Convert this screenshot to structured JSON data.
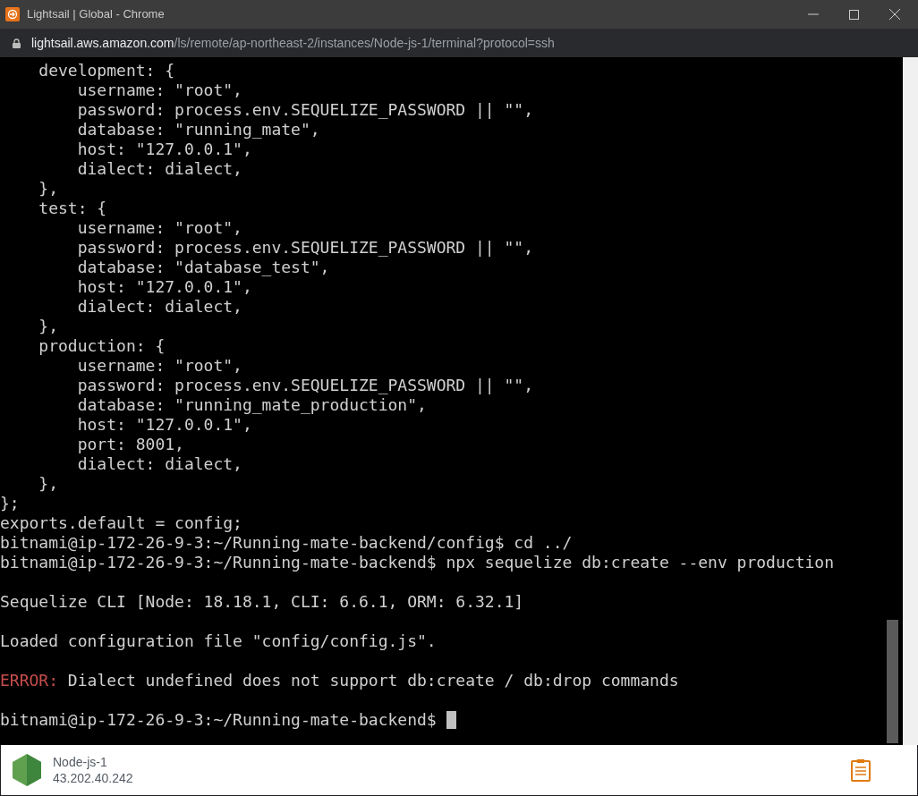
{
  "window": {
    "title": "Lightsail | Global - Chrome"
  },
  "address_bar": {
    "host": "lightsail.aws.amazon.com",
    "path": "/ls/remote/ap-northeast-2/instances/Node-js-1/terminal?protocol=ssh"
  },
  "terminal": {
    "lines": [
      {
        "kind": "plain",
        "text": "    development: {"
      },
      {
        "kind": "plain",
        "text": "        username: \"root\","
      },
      {
        "kind": "plain",
        "text": "        password: process.env.SEQUELIZE_PASSWORD || \"\","
      },
      {
        "kind": "plain",
        "text": "        database: \"running_mate\","
      },
      {
        "kind": "plain",
        "text": "        host: \"127.0.0.1\","
      },
      {
        "kind": "plain",
        "text": "        dialect: dialect,"
      },
      {
        "kind": "plain",
        "text": "    },"
      },
      {
        "kind": "plain",
        "text": "    test: {"
      },
      {
        "kind": "plain",
        "text": "        username: \"root\","
      },
      {
        "kind": "plain",
        "text": "        password: process.env.SEQUELIZE_PASSWORD || \"\","
      },
      {
        "kind": "plain",
        "text": "        database: \"database_test\","
      },
      {
        "kind": "plain",
        "text": "        host: \"127.0.0.1\","
      },
      {
        "kind": "plain",
        "text": "        dialect: dialect,"
      },
      {
        "kind": "plain",
        "text": "    },"
      },
      {
        "kind": "plain",
        "text": "    production: {"
      },
      {
        "kind": "plain",
        "text": "        username: \"root\","
      },
      {
        "kind": "plain",
        "text": "        password: process.env.SEQUELIZE_PASSWORD || \"\","
      },
      {
        "kind": "plain",
        "text": "        database: \"running_mate_production\","
      },
      {
        "kind": "plain",
        "text": "        host: \"127.0.0.1\","
      },
      {
        "kind": "plain",
        "text": "        port: 8001,"
      },
      {
        "kind": "plain",
        "text": "        dialect: dialect,"
      },
      {
        "kind": "plain",
        "text": "    },"
      },
      {
        "kind": "plain",
        "text": "};"
      },
      {
        "kind": "plain",
        "text": "exports.default = config;"
      },
      {
        "kind": "plain",
        "text": "bitnami@ip-172-26-9-3:~/Running-mate-backend/config$ cd ../"
      },
      {
        "kind": "plain",
        "text": "bitnami@ip-172-26-9-3:~/Running-mate-backend$ npx sequelize db:create --env production"
      },
      {
        "kind": "blank"
      },
      {
        "kind": "plain",
        "text": "Sequelize CLI [Node: 18.18.1, CLI: 6.6.1, ORM: 6.32.1]"
      },
      {
        "kind": "blank"
      },
      {
        "kind": "plain",
        "text": "Loaded configuration file \"config/config.js\"."
      },
      {
        "kind": "blank"
      },
      {
        "kind": "error",
        "label": "ERROR:",
        "text": " Dialect undefined does not support db:create / db:drop commands"
      },
      {
        "kind": "blank"
      },
      {
        "kind": "prompt",
        "text": "bitnami@ip-172-26-9-3:~/Running-mate-backend$ ",
        "cursor": true
      }
    ]
  },
  "footer": {
    "instance_name": "Node-js-1",
    "ip": "43.202.40.242"
  }
}
